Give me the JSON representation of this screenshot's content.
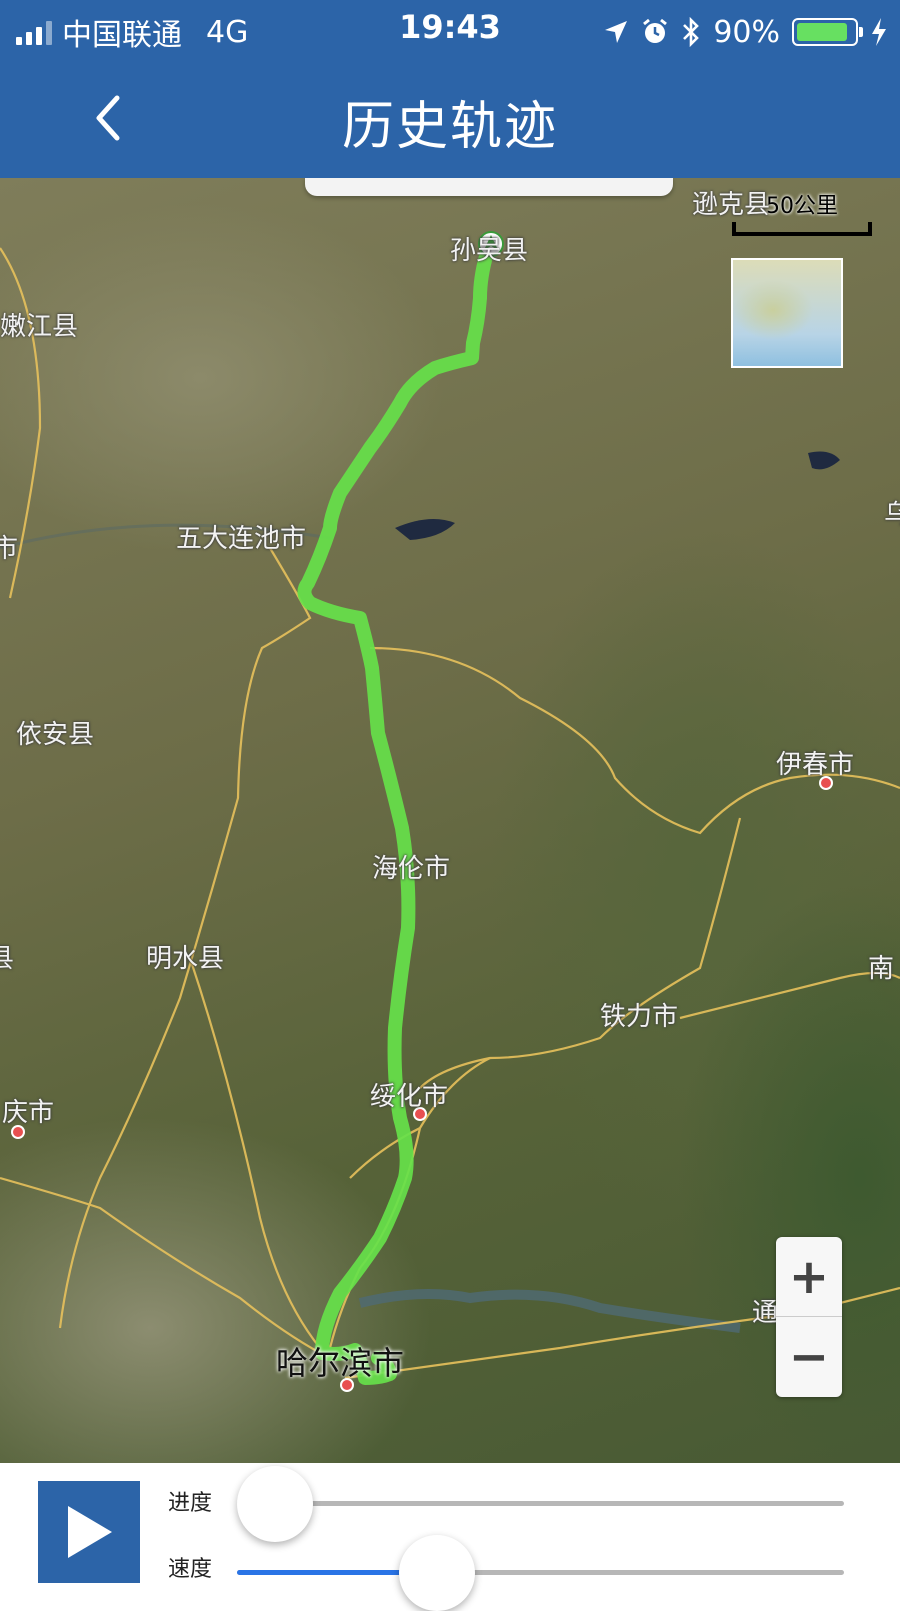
{
  "status_bar": {
    "carrier": "中国联通",
    "network": "4G",
    "time": "19:43",
    "battery": "90%",
    "battery_level": 0.9,
    "icons": [
      "signal-icon",
      "location-arrow-icon",
      "alarm-icon",
      "bluetooth-icon",
      "battery-icon",
      "charging-icon"
    ]
  },
  "header": {
    "title": "历史轨迹",
    "back_icon": "chevron-left-icon",
    "background": "#2c64a8"
  },
  "map": {
    "scale_label": "50公里",
    "route_color": "#66e14a",
    "labels": {
      "xunke": "逊克县",
      "sunwu": "孙吴县",
      "nenjiang": "嫩江县",
      "wudalianchi": "五大连池市",
      "yian": "依安县",
      "yichun": "伊春市",
      "hailun": "海伦市",
      "mingshui": "明水县",
      "tieli": "铁力市",
      "suihua": "绥化市",
      "daqing": "庆市",
      "harbin": "哈尔滨市",
      "tonghe": "通",
      "nan": "南",
      "wu": "乌",
      "shi": "市",
      "xian": "县"
    },
    "zoom_in": "+",
    "zoom_out": "−"
  },
  "controls": {
    "play_icon": "play-icon",
    "progress_label": "进度",
    "speed_label": "速度",
    "progress_value": 0.0,
    "speed_value": 0.33,
    "accent": "#2a74e6"
  }
}
